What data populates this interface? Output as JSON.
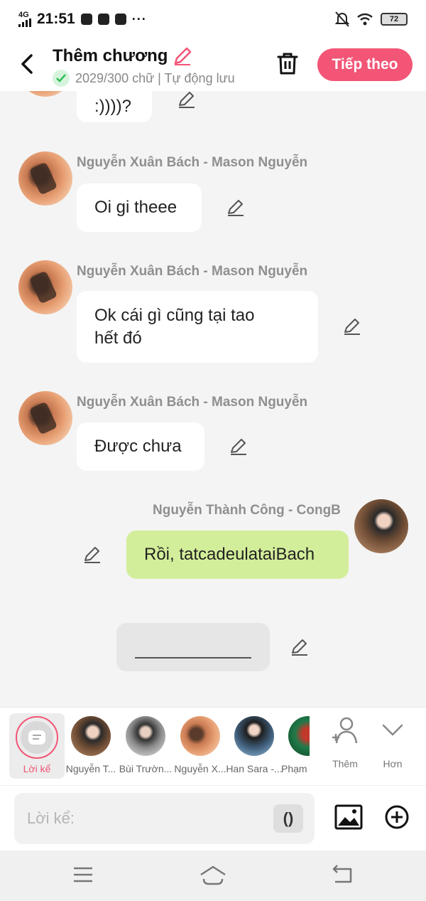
{
  "status_bar": {
    "network": "4G",
    "time": "21:51",
    "overflow": "···",
    "battery": "72"
  },
  "header": {
    "title": "Thêm chương",
    "subtitle": "2029/300 chữ | Tự động lưu",
    "next_label": "Tiếp theo"
  },
  "messages": [
    {
      "sender": "",
      "text": ":))))?",
      "side": "left"
    },
    {
      "sender": "Nguyễn Xuân Bách - Mason Nguyễn",
      "text": "Oi gi theee",
      "side": "left"
    },
    {
      "sender": "Nguyễn Xuân Bách - Mason Nguyễn",
      "text_lines": [
        "Ok cái gì cũng tại tao",
        "hết đó"
      ],
      "side": "left"
    },
    {
      "sender": "Nguyễn Xuân Bách - Mason Nguyễn",
      "text": "Được chưa",
      "side": "left"
    },
    {
      "sender": "Nguyễn Thành Công - CongB",
      "text": "Rồi, tatcadeulataiBach",
      "side": "right"
    },
    {
      "sender": "",
      "text": "",
      "side": "narration"
    }
  ],
  "characters": {
    "narrator_label": "Lời kể",
    "items": [
      {
        "label": "Nguyễn T..."
      },
      {
        "label": "Bùi Trườn..."
      },
      {
        "label": "Nguyễn X..."
      },
      {
        "label": "Han Sara -..."
      },
      {
        "label": "Phạm"
      }
    ],
    "add_label": "Thêm",
    "more_label": "Hơn"
  },
  "input": {
    "placeholder": "Lời kể:",
    "paren_label": "()"
  },
  "colors": {
    "accent": "#f25576",
    "bubble_green": "#d3ee9a",
    "check_green": "#2fbf55"
  }
}
